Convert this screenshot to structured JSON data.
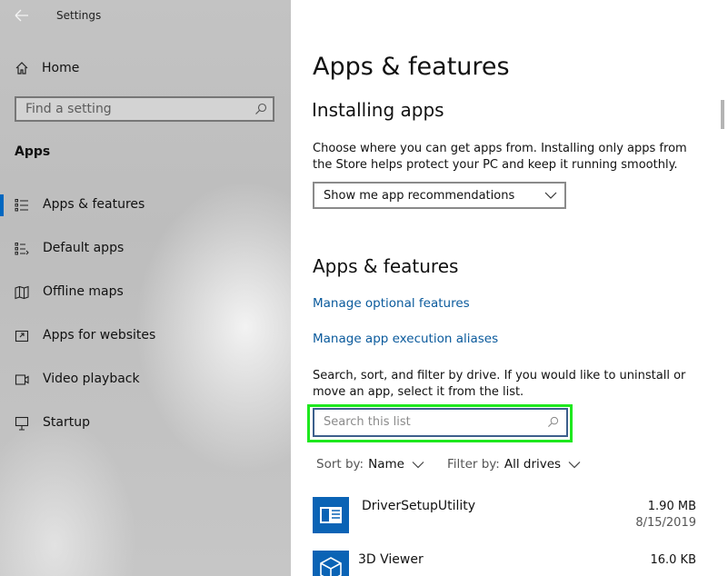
{
  "window": {
    "title": "Settings"
  },
  "sidebar": {
    "home_label": "Home",
    "search_placeholder": "Find a setting",
    "section_title": "Apps",
    "items": [
      {
        "label": "Apps & features",
        "icon": "apps-features-icon",
        "active": true
      },
      {
        "label": "Default apps",
        "icon": "default-apps-icon",
        "active": false
      },
      {
        "label": "Offline maps",
        "icon": "map-icon",
        "active": false
      },
      {
        "label": "Apps for websites",
        "icon": "apps-for-websites-icon",
        "active": false
      },
      {
        "label": "Video playback",
        "icon": "video-icon",
        "active": false
      },
      {
        "label": "Startup",
        "icon": "startup-icon",
        "active": false
      }
    ]
  },
  "main": {
    "page_title": "Apps & features",
    "installing": {
      "title": "Installing apps",
      "description": "Choose where you can get apps from. Installing only apps from the Store helps protect your PC and keep it running smoothly.",
      "dropdown_value": "Show me app recommendations"
    },
    "apps_features": {
      "title": "Apps & features",
      "link_optional": "Manage optional features",
      "link_aliases": "Manage app execution aliases",
      "description": "Search, sort, and filter by drive. If you would like to uninstall or move an app, select it from the list.",
      "search_placeholder": "Search this list",
      "sort_label": "Sort by:",
      "sort_value": "Name",
      "filter_label": "Filter by:",
      "filter_value": "All drives"
    },
    "apps": [
      {
        "name": "DriverSetupUtility",
        "size": "1.90 MB",
        "date": "8/15/2019"
      },
      {
        "name": "3D Viewer",
        "size": "16.0 KB",
        "date": ""
      }
    ]
  },
  "colors": {
    "accent": "#0067c0",
    "link": "#0a5a9c",
    "highlight": "#1ee81e",
    "sidebar_bg": "#c3c3c3"
  }
}
